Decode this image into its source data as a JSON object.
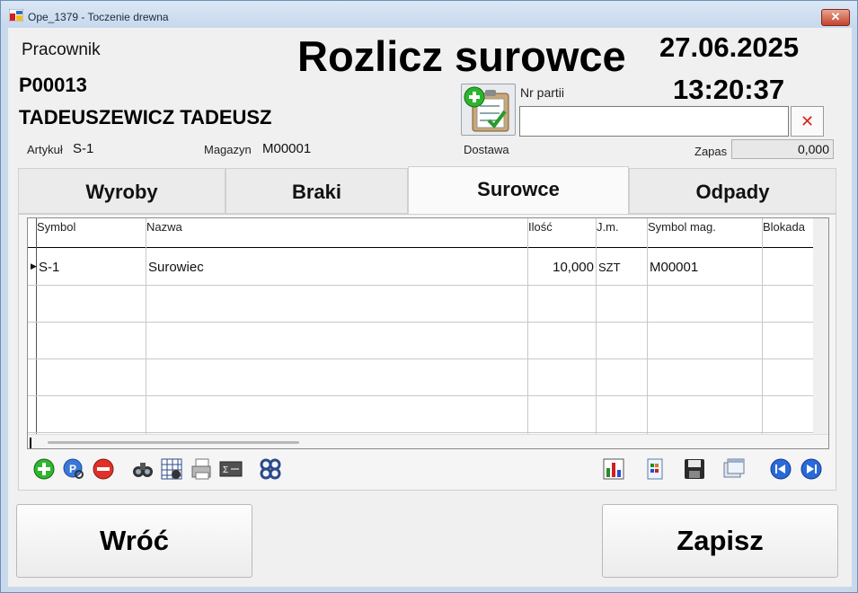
{
  "window": {
    "title": "Ope_1379 - Toczenie drewna",
    "close_label": "✕"
  },
  "header": {
    "worker_label": "Pracownik",
    "worker_code": "P00013",
    "worker_name": "TADEUSZEWICZ TADEUSZ",
    "title": "Rozlicz surowce",
    "date": "27.06.2025",
    "time": "13:20:37",
    "article_label": "Artykuł",
    "article_value": "S-1",
    "warehouse_label": "Magazyn",
    "warehouse_value": "M00001",
    "delivery_label": "Dostawa",
    "batch_label": "Nr partii",
    "batch_value": "",
    "clear_label": "✕",
    "stock_label": "Zapas",
    "stock_value": "0,000"
  },
  "tabs": [
    {
      "label": "Wyroby",
      "active": false
    },
    {
      "label": "Braki",
      "active": false
    },
    {
      "label": "Surowce",
      "active": true
    },
    {
      "label": "Odpady",
      "active": false
    }
  ],
  "grid": {
    "columns": [
      "Symbol",
      "Nazwa",
      "Ilość",
      "J.m.",
      "Symbol mag.",
      "Blokada"
    ],
    "rows": [
      {
        "symbol": "S-1",
        "nazwa": "Surowiec",
        "ilosc": "10,000",
        "jm": "SZT",
        "symbol_mag": "M00001",
        "blokada": ""
      }
    ]
  },
  "toolbar": {
    "icons": [
      "add-icon",
      "find-icon",
      "remove-icon",
      "binoculars-icon",
      "grid-filter-icon",
      "print-icon",
      "sum-icon",
      "settings-icon",
      "chart-icon",
      "export-icon",
      "save-icon",
      "windows-icon",
      "first-icon",
      "last-icon"
    ]
  },
  "buttons": {
    "back_label": "Wróć",
    "save_label": "Zapisz"
  }
}
